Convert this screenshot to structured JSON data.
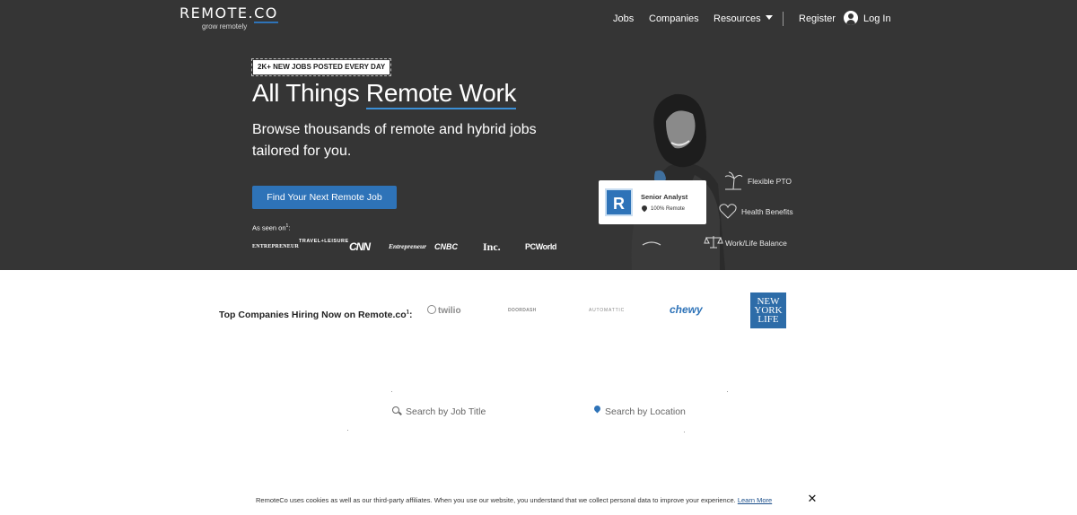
{
  "header": {
    "logo_text": "REMOTE.",
    "logo_suffix": "CO",
    "tagline": "grow remotely",
    "nav": {
      "jobs": "Jobs",
      "companies": "Companies",
      "resources": "Resources",
      "register": "Register",
      "login": "Log In"
    }
  },
  "hero": {
    "badge": "2K+ NEW JOBS POSTED EVERY DAY",
    "title_prefix": "All Things ",
    "title_highlight": "Remote Work",
    "subtitle": "Browse thousands of remote and hybrid jobs tailored for you.",
    "cta_label": "Find Your Next Remote Job",
    "as_seen_on": "As seen on",
    "as_seen_on_sup": "1",
    "press_logos": [
      "ENTREPRENEUR",
      "TRAVEL+LEISURE",
      "CNN",
      "Entrepreneur",
      "CNBC",
      "Inc.",
      "PCWorld"
    ],
    "job_card": {
      "logo_letter": "R",
      "title": "Senior Analyst",
      "location": "100% Remote"
    },
    "benefits": [
      "Flexible PTO",
      "Health Benefits",
      "Work/Life Balance"
    ]
  },
  "companies": {
    "label": "Top Companies Hiring Now on Remote.co",
    "label_sup": "1",
    "label_suffix": ":",
    "logos": [
      "twilio",
      "DOORDASH",
      "AUTOMATTIC",
      "chewy",
      "NEW YORK LIFE"
    ]
  },
  "search": {
    "job_title_placeholder": "Search by Job Title",
    "location_placeholder": "Search by Location"
  },
  "cookie": {
    "text": "RemoteCo uses cookies as well as our third-party affiliates. When you use our website, you understand that we collect personal data to improve your experience.",
    "link": "Learn More",
    "close": "✕"
  },
  "colors": {
    "hero_bg": "#353535",
    "accent": "#2e73b8",
    "text_dark": "#222222"
  }
}
